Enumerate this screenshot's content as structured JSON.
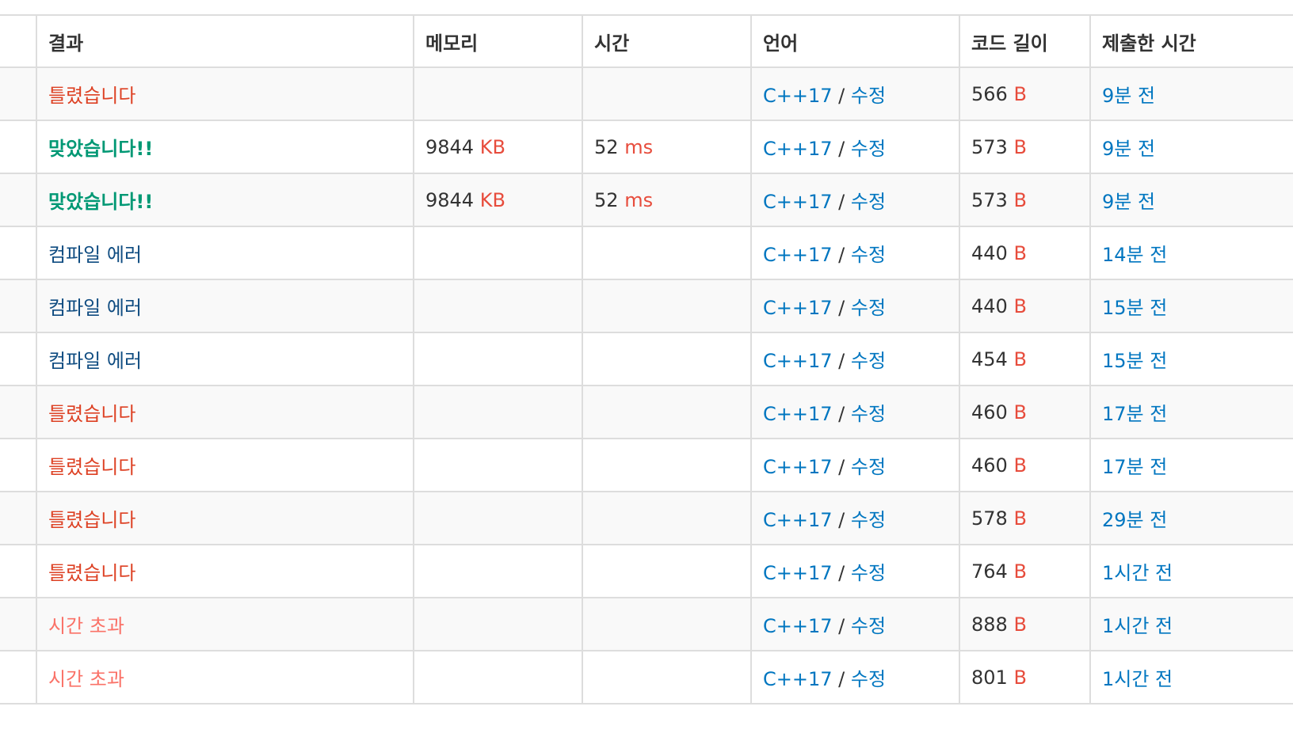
{
  "headers": {
    "result": "결과",
    "memory": "메모리",
    "time": "시간",
    "language": "언어",
    "code_length": "코드 길이",
    "submitted": "제출한 시간"
  },
  "rows": [
    {
      "result": "틀렸습니다",
      "result_type": "wa",
      "memory": "",
      "memory_unit": "",
      "time": "",
      "time_unit": "",
      "lang": "C++17",
      "sep": " / ",
      "edit": "수정",
      "length": "566",
      "length_unit": "B",
      "when": "9분 전"
    },
    {
      "result": "맞았습니다!!",
      "result_type": "ac",
      "memory": "9844",
      "memory_unit": "KB",
      "time": "52",
      "time_unit": "ms",
      "lang": "C++17",
      "sep": " / ",
      "edit": "수정",
      "length": "573",
      "length_unit": "B",
      "when": "9분 전"
    },
    {
      "result": "맞았습니다!!",
      "result_type": "ac",
      "memory": "9844",
      "memory_unit": "KB",
      "time": "52",
      "time_unit": "ms",
      "lang": "C++17",
      "sep": " / ",
      "edit": "수정",
      "length": "573",
      "length_unit": "B",
      "when": "9분 전"
    },
    {
      "result": "컴파일 에러",
      "result_type": "ce",
      "memory": "",
      "memory_unit": "",
      "time": "",
      "time_unit": "",
      "lang": "C++17",
      "sep": " / ",
      "edit": "수정",
      "length": "440",
      "length_unit": "B",
      "when": "14분 전"
    },
    {
      "result": "컴파일 에러",
      "result_type": "ce",
      "memory": "",
      "memory_unit": "",
      "time": "",
      "time_unit": "",
      "lang": "C++17",
      "sep": " / ",
      "edit": "수정",
      "length": "440",
      "length_unit": "B",
      "when": "15분 전"
    },
    {
      "result": "컴파일 에러",
      "result_type": "ce",
      "memory": "",
      "memory_unit": "",
      "time": "",
      "time_unit": "",
      "lang": "C++17",
      "sep": " / ",
      "edit": "수정",
      "length": "454",
      "length_unit": "B",
      "when": "15분 전"
    },
    {
      "result": "틀렸습니다",
      "result_type": "wa",
      "memory": "",
      "memory_unit": "",
      "time": "",
      "time_unit": "",
      "lang": "C++17",
      "sep": " / ",
      "edit": "수정",
      "length": "460",
      "length_unit": "B",
      "when": "17분 전"
    },
    {
      "result": "틀렸습니다",
      "result_type": "wa",
      "memory": "",
      "memory_unit": "",
      "time": "",
      "time_unit": "",
      "lang": "C++17",
      "sep": " / ",
      "edit": "수정",
      "length": "460",
      "length_unit": "B",
      "when": "17분 전"
    },
    {
      "result": "틀렸습니다",
      "result_type": "wa",
      "memory": "",
      "memory_unit": "",
      "time": "",
      "time_unit": "",
      "lang": "C++17",
      "sep": " / ",
      "edit": "수정",
      "length": "578",
      "length_unit": "B",
      "when": "29분 전"
    },
    {
      "result": "틀렸습니다",
      "result_type": "wa",
      "memory": "",
      "memory_unit": "",
      "time": "",
      "time_unit": "",
      "lang": "C++17",
      "sep": " / ",
      "edit": "수정",
      "length": "764",
      "length_unit": "B",
      "when": "1시간 전"
    },
    {
      "result": "시간 초과",
      "result_type": "tle",
      "memory": "",
      "memory_unit": "",
      "time": "",
      "time_unit": "",
      "lang": "C++17",
      "sep": " / ",
      "edit": "수정",
      "length": "888",
      "length_unit": "B",
      "when": "1시간 전"
    },
    {
      "result": "시간 초과",
      "result_type": "tle",
      "memory": "",
      "memory_unit": "",
      "time": "",
      "time_unit": "",
      "lang": "C++17",
      "sep": " / ",
      "edit": "수정",
      "length": "801",
      "length_unit": "B",
      "when": "1시간 전"
    }
  ],
  "colors": {
    "wrong_answer": "#dd4124",
    "accepted": "#009874",
    "compile_error": "#0f4c81",
    "time_limit": "#fa7268",
    "link": "#0076c0",
    "unit": "#e74c3c",
    "stripe": "#f9f9f9",
    "border": "#dddddd"
  }
}
